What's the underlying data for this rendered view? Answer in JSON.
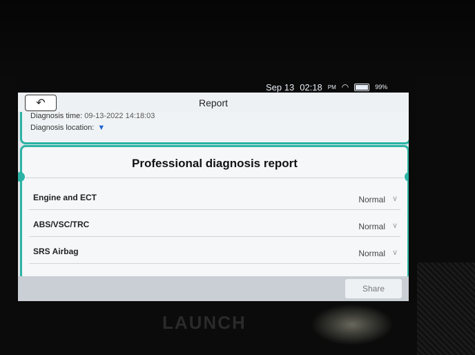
{
  "status_bar": {
    "date": "Sep 13",
    "time": "02:18",
    "ampm": "PM",
    "wifi_icon": "wifi-icon",
    "battery_pct": "99%"
  },
  "header": {
    "back_icon": "back-arrow-icon",
    "title": "Report"
  },
  "diagnosis_info": {
    "time_label": "Diagnosis time:",
    "time_value": "09-13-2022 14:18:03",
    "location_label": "Diagnosis location:",
    "location_icon": "location-pin-icon"
  },
  "report": {
    "title": "Professional diagnosis report",
    "rows": [
      {
        "name": "Engine and ECT",
        "status": "Normal"
      },
      {
        "name": "ABS/VSC/TRC",
        "status": "Normal"
      },
      {
        "name": "SRS Airbag",
        "status": "Normal"
      }
    ]
  },
  "footer": {
    "share_label": "Share"
  },
  "device": {
    "brand": "LAUNCH"
  },
  "colors": {
    "accent": "#2bb3a5",
    "location_icon": "#1e63d6"
  }
}
